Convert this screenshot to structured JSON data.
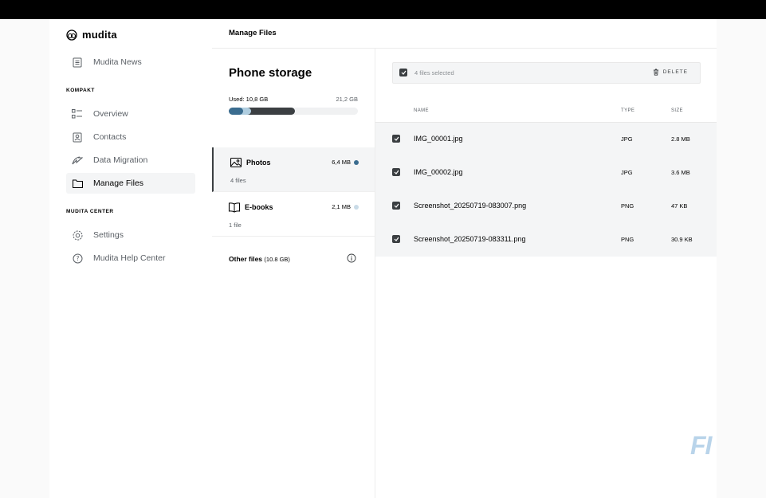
{
  "app": {
    "name": "mudita"
  },
  "sidebar": {
    "top_item": {
      "label": "Mudita News",
      "icon": "news-icon"
    },
    "sections": [
      {
        "label": "KOMPAKT"
      },
      {
        "label": "MUDITA CENTER"
      }
    ],
    "kompakt_items": [
      {
        "label": "Overview",
        "icon": "overview-icon"
      },
      {
        "label": "Contacts",
        "icon": "contacts-icon"
      },
      {
        "label": "Data Migration",
        "icon": "migration-icon"
      },
      {
        "label": "Manage Files",
        "icon": "folder-icon",
        "active": true
      }
    ],
    "center_items": [
      {
        "label": "Settings",
        "icon": "gear-icon"
      },
      {
        "label": "Mudita Help Center",
        "icon": "help-icon"
      }
    ]
  },
  "header": {
    "title": "Manage Files"
  },
  "storage": {
    "title": "Phone storage",
    "used_label": "Used: 10,8 GB",
    "total_label": "21,2 GB",
    "used_fraction": 0.51,
    "categories": [
      {
        "name": "Photos",
        "size": "6,4 MB",
        "count": "4 files",
        "dot_color": "#3a6c8f",
        "active": true
      },
      {
        "name": "E-books",
        "size": "2,1 MB",
        "count": "1 file",
        "dot_color": "#c9dbe7",
        "active": false
      }
    ],
    "other": {
      "label": "Other files",
      "size": "(10.8 GB)"
    }
  },
  "files": {
    "selection_text": "4 files selected",
    "delete_label": "DELETE",
    "columns": {
      "name": "NAME",
      "type": "TYPE",
      "size": "SIZE"
    },
    "rows": [
      {
        "name": "IMG_00001.jpg",
        "type": "JPG",
        "size": "2.8 MB",
        "checked": true
      },
      {
        "name": "IMG_00002.jpg",
        "type": "JPG",
        "size": "3.6 MB",
        "checked": true
      },
      {
        "name": "Screenshot_20250719-083007.png",
        "type": "PNG",
        "size": "47 KB",
        "checked": true
      },
      {
        "name": "Screenshot_20250719-083311.png",
        "type": "PNG",
        "size": "30.9 KB",
        "checked": true
      }
    ]
  },
  "colors": {
    "accent_dark": "#3b3f42",
    "accent_blue": "#3a6c8f",
    "accent_light_blue": "#afcddf",
    "selected_bg": "#f4f5f6"
  },
  "watermark": {
    "text": "FI"
  }
}
